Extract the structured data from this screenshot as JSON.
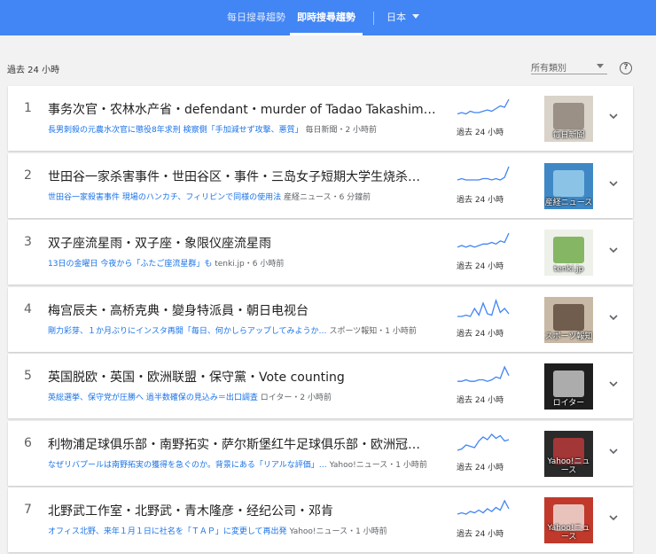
{
  "header": {
    "tab_daily": "每日搜尋趨勢",
    "tab_realtime": "即時搜尋趨勢",
    "country": "日本"
  },
  "filters": {
    "timeframe": "過去 24 小時",
    "category": "所有類別",
    "help": "?"
  },
  "colors": {
    "header_blue": "#4285f4",
    "link_blue": "#1a73e8",
    "sparkline_blue": "#4285f4"
  },
  "trends": [
    {
      "rank": "1",
      "title": "事务次官・农林水产省・defendant・murder of Tadao Takashima's…",
      "article": "長男刺殺の元農水次官に懲役8年求刑 検察側「手加減せず攻撃、悪質」",
      "source": "毎日新聞・2 小時前",
      "spark_label": "過去 24 小時",
      "thumb_label": "毎日新聞",
      "spark": [
        3,
        4,
        3,
        5,
        4,
        4,
        5,
        6,
        5,
        7,
        9,
        8,
        14
      ]
    },
    {
      "rank": "2",
      "title": "世田谷一家杀害事件・世田谷区・事件・三岛女子短期大学生烧杀…",
      "article": "世田谷一家殺害事件 現場のハンカチ、フィリピンで同様の使用法",
      "source": "産経ニュース・6 分鐘前",
      "spark_label": "過去 24 小時",
      "thumb_label": "産経ニュース",
      "spark": [
        4,
        5,
        4,
        4,
        4,
        4,
        5,
        5,
        4,
        5,
        4,
        6,
        14
      ]
    },
    {
      "rank": "3",
      "title": "双子座流星雨・双子座・象限仪座流星雨",
      "article": "13日の金曜日 今夜から「ふたご座流星群」も",
      "source": "tenki.jp・6 小時前",
      "spark_label": "過去 24 小時",
      "thumb_label": "tenki.jp",
      "spark": [
        3,
        4,
        3,
        4,
        3,
        4,
        5,
        5,
        6,
        5,
        7,
        6,
        12
      ]
    },
    {
      "rank": "4",
      "title": "梅宫辰夫・高桥克典・變身特派員・朝日电视台",
      "article": "剛力彩芽、１か月ぶりにインスタ再開「毎日、何かしらアップしてみようか…",
      "source": "スポーツ報知・1 小時前",
      "spark_label": "過去 24 小時",
      "thumb_label": "スポーツ報知",
      "spark": [
        2,
        2,
        3,
        2,
        8,
        3,
        12,
        4,
        3,
        14,
        5,
        8,
        4
      ]
    },
    {
      "rank": "5",
      "title": "英国脱欧・英国・欧洲联盟・保守黨・Vote counting",
      "article": "英総選挙、保守党が圧勝へ 過半数確保の見込み＝出口調査",
      "source": "ロイター・2 小時前",
      "spark_label": "過去 24 小時",
      "thumb_label": "ロイター",
      "spark": [
        3,
        3,
        4,
        3,
        3,
        4,
        4,
        3,
        4,
        6,
        5,
        13,
        7
      ]
    },
    {
      "rank": "6",
      "title": "利物浦足球俱乐部・南野拓实・萨尔斯堡红牛足球俱乐部・欧洲冠…",
      "article": "なぜリバプールは南野拓実の獲得を急ぐのか。背景にある「リアルな評価」…",
      "source": "Yahoo!ニュース・1 小時前",
      "spark_label": "過去 24 小時",
      "thumb_label": "Yahoo!ニュース",
      "spark": [
        2,
        3,
        6,
        5,
        4,
        9,
        12,
        10,
        14,
        11,
        13,
        9,
        10
      ]
    },
    {
      "rank": "7",
      "title": "北野武工作室・北野武・青木隆彦・经纪公司・邓肯",
      "article": "オフィス北野、来年１月１日に社名を「ＴＡＰ」に変更して再出発",
      "source": "Yahoo!ニュース・1 小時前",
      "spark_label": "過去 24 小時",
      "thumb_label": "Yahoo!ニュース",
      "spark": [
        4,
        5,
        4,
        6,
        5,
        7,
        5,
        8,
        6,
        9,
        7,
        14,
        8
      ]
    }
  ]
}
